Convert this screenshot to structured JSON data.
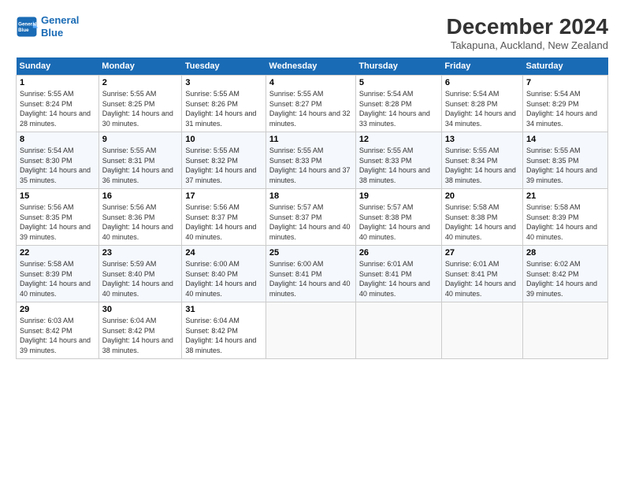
{
  "logo": {
    "line1": "General",
    "line2": "Blue"
  },
  "title": "December 2024",
  "subtitle": "Takapuna, Auckland, New Zealand",
  "days_header": [
    "Sunday",
    "Monday",
    "Tuesday",
    "Wednesday",
    "Thursday",
    "Friday",
    "Saturday"
  ],
  "weeks": [
    [
      {
        "num": "1",
        "rise": "5:55 AM",
        "set": "8:24 PM",
        "daylight": "14 hours and 28 minutes."
      },
      {
        "num": "2",
        "rise": "5:55 AM",
        "set": "8:25 PM",
        "daylight": "14 hours and 30 minutes."
      },
      {
        "num": "3",
        "rise": "5:55 AM",
        "set": "8:26 PM",
        "daylight": "14 hours and 31 minutes."
      },
      {
        "num": "4",
        "rise": "5:55 AM",
        "set": "8:27 PM",
        "daylight": "14 hours and 32 minutes."
      },
      {
        "num": "5",
        "rise": "5:54 AM",
        "set": "8:28 PM",
        "daylight": "14 hours and 33 minutes."
      },
      {
        "num": "6",
        "rise": "5:54 AM",
        "set": "8:28 PM",
        "daylight": "14 hours and 34 minutes."
      },
      {
        "num": "7",
        "rise": "5:54 AM",
        "set": "8:29 PM",
        "daylight": "14 hours and 34 minutes."
      }
    ],
    [
      {
        "num": "8",
        "rise": "5:54 AM",
        "set": "8:30 PM",
        "daylight": "14 hours and 35 minutes."
      },
      {
        "num": "9",
        "rise": "5:55 AM",
        "set": "8:31 PM",
        "daylight": "14 hours and 36 minutes."
      },
      {
        "num": "10",
        "rise": "5:55 AM",
        "set": "8:32 PM",
        "daylight": "14 hours and 37 minutes."
      },
      {
        "num": "11",
        "rise": "5:55 AM",
        "set": "8:33 PM",
        "daylight": "14 hours and 37 minutes."
      },
      {
        "num": "12",
        "rise": "5:55 AM",
        "set": "8:33 PM",
        "daylight": "14 hours and 38 minutes."
      },
      {
        "num": "13",
        "rise": "5:55 AM",
        "set": "8:34 PM",
        "daylight": "14 hours and 38 minutes."
      },
      {
        "num": "14",
        "rise": "5:55 AM",
        "set": "8:35 PM",
        "daylight": "14 hours and 39 minutes."
      }
    ],
    [
      {
        "num": "15",
        "rise": "5:56 AM",
        "set": "8:35 PM",
        "daylight": "14 hours and 39 minutes."
      },
      {
        "num": "16",
        "rise": "5:56 AM",
        "set": "8:36 PM",
        "daylight": "14 hours and 40 minutes."
      },
      {
        "num": "17",
        "rise": "5:56 AM",
        "set": "8:37 PM",
        "daylight": "14 hours and 40 minutes."
      },
      {
        "num": "18",
        "rise": "5:57 AM",
        "set": "8:37 PM",
        "daylight": "14 hours and 40 minutes."
      },
      {
        "num": "19",
        "rise": "5:57 AM",
        "set": "8:38 PM",
        "daylight": "14 hours and 40 minutes."
      },
      {
        "num": "20",
        "rise": "5:58 AM",
        "set": "8:38 PM",
        "daylight": "14 hours and 40 minutes."
      },
      {
        "num": "21",
        "rise": "5:58 AM",
        "set": "8:39 PM",
        "daylight": "14 hours and 40 minutes."
      }
    ],
    [
      {
        "num": "22",
        "rise": "5:58 AM",
        "set": "8:39 PM",
        "daylight": "14 hours and 40 minutes."
      },
      {
        "num": "23",
        "rise": "5:59 AM",
        "set": "8:40 PM",
        "daylight": "14 hours and 40 minutes."
      },
      {
        "num": "24",
        "rise": "6:00 AM",
        "set": "8:40 PM",
        "daylight": "14 hours and 40 minutes."
      },
      {
        "num": "25",
        "rise": "6:00 AM",
        "set": "8:41 PM",
        "daylight": "14 hours and 40 minutes."
      },
      {
        "num": "26",
        "rise": "6:01 AM",
        "set": "8:41 PM",
        "daylight": "14 hours and 40 minutes."
      },
      {
        "num": "27",
        "rise": "6:01 AM",
        "set": "8:41 PM",
        "daylight": "14 hours and 40 minutes."
      },
      {
        "num": "28",
        "rise": "6:02 AM",
        "set": "8:42 PM",
        "daylight": "14 hours and 39 minutes."
      }
    ],
    [
      {
        "num": "29",
        "rise": "6:03 AM",
        "set": "8:42 PM",
        "daylight": "14 hours and 39 minutes."
      },
      {
        "num": "30",
        "rise": "6:04 AM",
        "set": "8:42 PM",
        "daylight": "14 hours and 38 minutes."
      },
      {
        "num": "31",
        "rise": "6:04 AM",
        "set": "8:42 PM",
        "daylight": "14 hours and 38 minutes."
      },
      null,
      null,
      null,
      null
    ]
  ]
}
